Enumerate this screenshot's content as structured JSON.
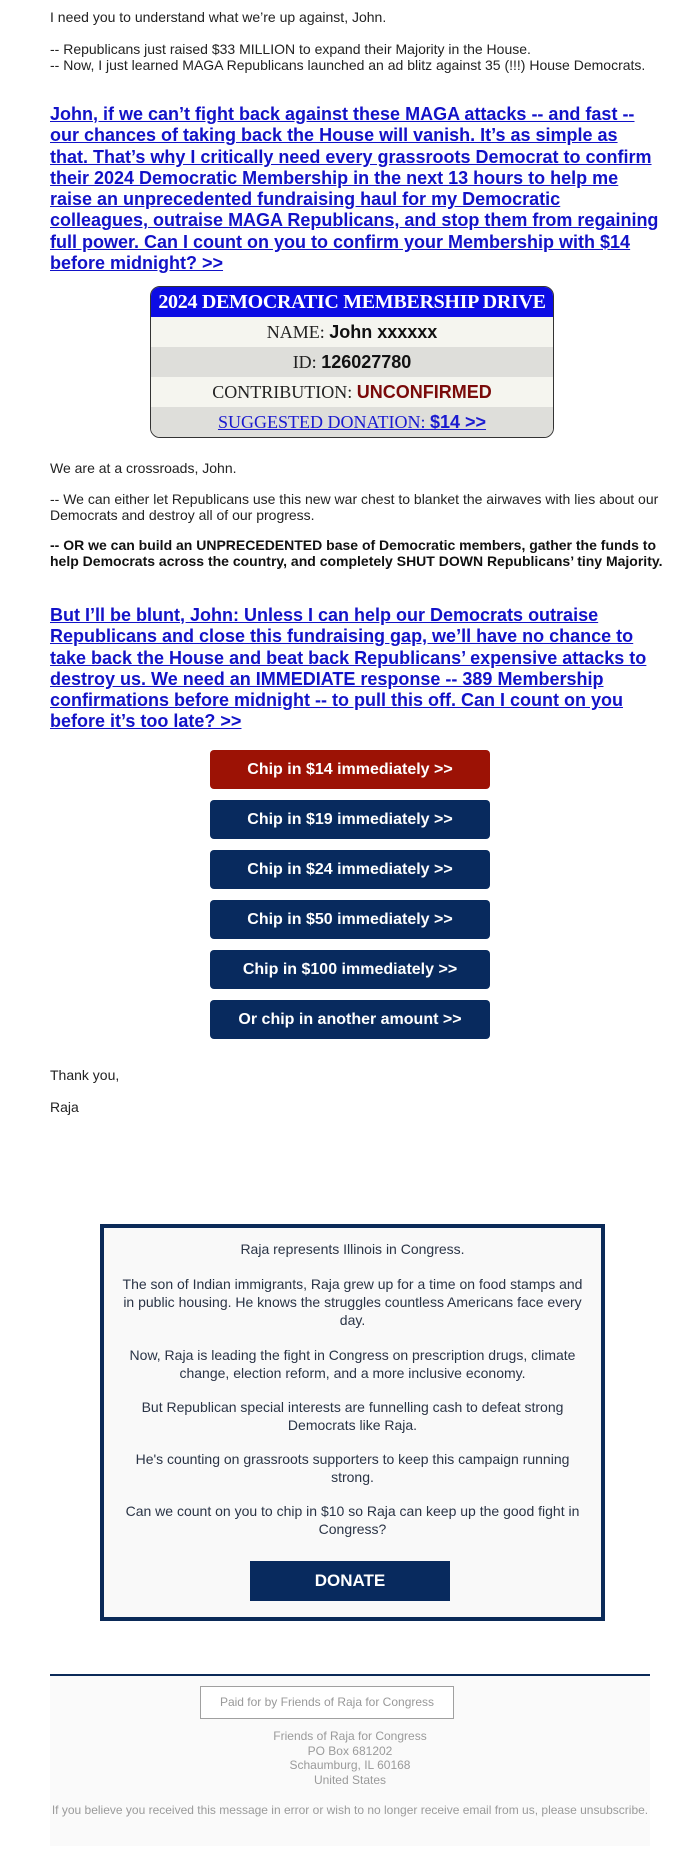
{
  "email": {
    "intro": "I need you to understand what we’re up against, John.",
    "bullets": [
      "-- Republicans just raised $33 MILLION to expand their Majority in the House.",
      "-- Now, I just learned MAGA Republicans launched an ad blitz against 35 (!!!) House Democrats."
    ],
    "headline_link_1": "John, if we can’t fight back against these MAGA attacks -- and fast -- our chances of taking back the House will vanish. It’s as simple as that. That’s why I critically need every grassroots Democrat to confirm their 2024 Democratic Membership in the next 13 hours to help me raise an unprecedented fundraising haul for my Democratic colleagues, outraise MAGA Republicans, and stop them from regaining full power. Can I count on you to confirm your Membership with $14 before midnight? >>",
    "membership_box": {
      "title": "2024 DEMOCRATIC MEMBERSHIP DRIVE",
      "name_label": "NAME: ",
      "name_value": "John xxxxxx",
      "id_label": "ID: ",
      "id_value": "126027780",
      "contribution_label": "CONTRIBUTION: ",
      "contribution_value": "UNCONFIRMED",
      "suggested_label": "SUGGESTED DONATION: ",
      "suggested_value": "$14 >>",
      "colors": {
        "header": "#0c0ce4",
        "unconfirmed": "#7a0a0a",
        "link": "#1a1ad0"
      }
    },
    "crossroads": "We are at a crossroads, John.",
    "option_1": "-- We can either let Republicans use this new war chest to blanket the airwaves with lies about our Democrats and destroy all of our progress.",
    "option_2": "-- OR we can build an UNPRECEDENTED base of Democratic members, gather the funds to help Democrats across the country, and completely SHUT DOWN Republicans’ tiny Majority.",
    "headline_link_2": "But I’ll be blunt, John: Unless I can help our Democrats outraise Republicans and close this fundraising gap, we’ll have no chance to take back the House and beat back Republicans’ expensive attacks to destroy us. We need an IMMEDIATE response -- 389 Membership confirmations before midnight -- to pull this off. Can I count on you before it’s too late? >>",
    "donation_buttons": [
      {
        "label": "Chip in $14 immediately >>",
        "color": "#9c1205"
      },
      {
        "label": "Chip in $19 immediately >>",
        "color": "#082a5e"
      },
      {
        "label": "Chip in $24 immediately >>",
        "color": "#082a5e"
      },
      {
        "label": "Chip in $50 immediately >>",
        "color": "#082a5e"
      },
      {
        "label": "Chip in $100 immediately >>",
        "color": "#082a5e"
      },
      {
        "label": "Or chip in another amount >>",
        "color": "#082a5e"
      }
    ],
    "closing": "Thank you,",
    "signature": "Raja"
  },
  "bio_box": {
    "paragraphs": [
      "Raja represents Illinois in Congress.",
      "The son of Indian immigrants, Raja grew up for a time on food stamps and in public housing. He knows the struggles countless Americans face every day.",
      "Now, Raja is leading the fight in Congress on prescription drugs, climate change, election reform, and a more inclusive economy.",
      "But Republican special interests are funnelling cash to defeat strong Democrats like Raja.",
      "He's counting on grassroots supporters to keep this campaign running strong.",
      "Can we count on you to chip in $10 so Raja can keep up the good fight in Congress?"
    ],
    "donate_label": "DONATE"
  },
  "footer": {
    "paid_for": "Paid for by Friends of Raja for Congress",
    "address": [
      "Friends of Raja for Congress",
      "PO Box 681202",
      "Schaumburg, IL 60168",
      "United States"
    ],
    "unsubscribe_text": "If you believe you received this message in error or wish to no longer receive email from us, please unsubscribe."
  }
}
